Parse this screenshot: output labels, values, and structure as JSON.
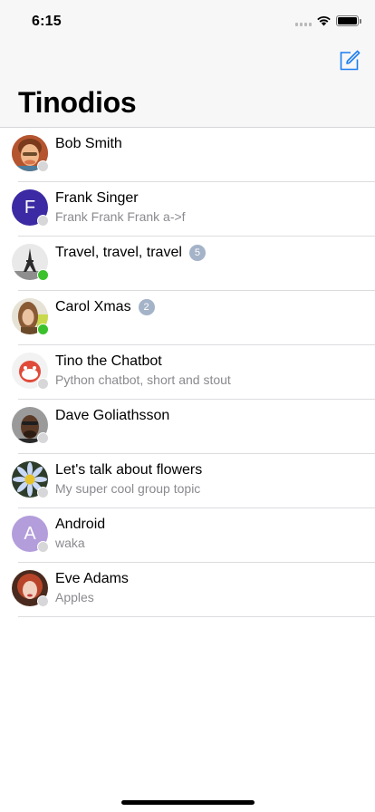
{
  "status_bar": {
    "time": "6:15"
  },
  "header": {
    "title": "Tinodios",
    "compose_icon": "compose-icon"
  },
  "colors": {
    "accent": "#1a7cf2",
    "online": "#3bc12c",
    "offline": "#d7d7d9",
    "badge": "#a4b3c8",
    "subtitle": "#8a8a8f"
  },
  "chats": [
    {
      "name": "Bob Smith",
      "subtitle": "",
      "badge": "",
      "online": false,
      "avatar": "photo"
    },
    {
      "name": "Frank Singer",
      "subtitle": "Frank Frank Frank a->f",
      "badge": "",
      "online": false,
      "avatar": "letter",
      "letter": "F",
      "avatar_color": "#3b2aa3"
    },
    {
      "name": "Travel, travel, travel",
      "subtitle": "",
      "badge": "5",
      "online": true,
      "avatar": "photo"
    },
    {
      "name": "Carol Xmas",
      "subtitle": "",
      "badge": "2",
      "online": true,
      "avatar": "photo"
    },
    {
      "name": "Tino the Chatbot",
      "subtitle": "Python chatbot, short and stout",
      "badge": "",
      "online": false,
      "avatar": "photo"
    },
    {
      "name": "Dave Goliathsson",
      "subtitle": "",
      "badge": "",
      "online": false,
      "avatar": "photo"
    },
    {
      "name": "Let's talk about flowers",
      "subtitle": "My super cool group topic",
      "badge": "",
      "online": false,
      "avatar": "photo"
    },
    {
      "name": "Android",
      "subtitle": "waka",
      "badge": "",
      "online": false,
      "avatar": "letter",
      "letter": "A",
      "avatar_color": "#b39ddb"
    },
    {
      "name": "Eve Adams",
      "subtitle": "Apples",
      "badge": "",
      "online": false,
      "avatar": "photo"
    }
  ]
}
